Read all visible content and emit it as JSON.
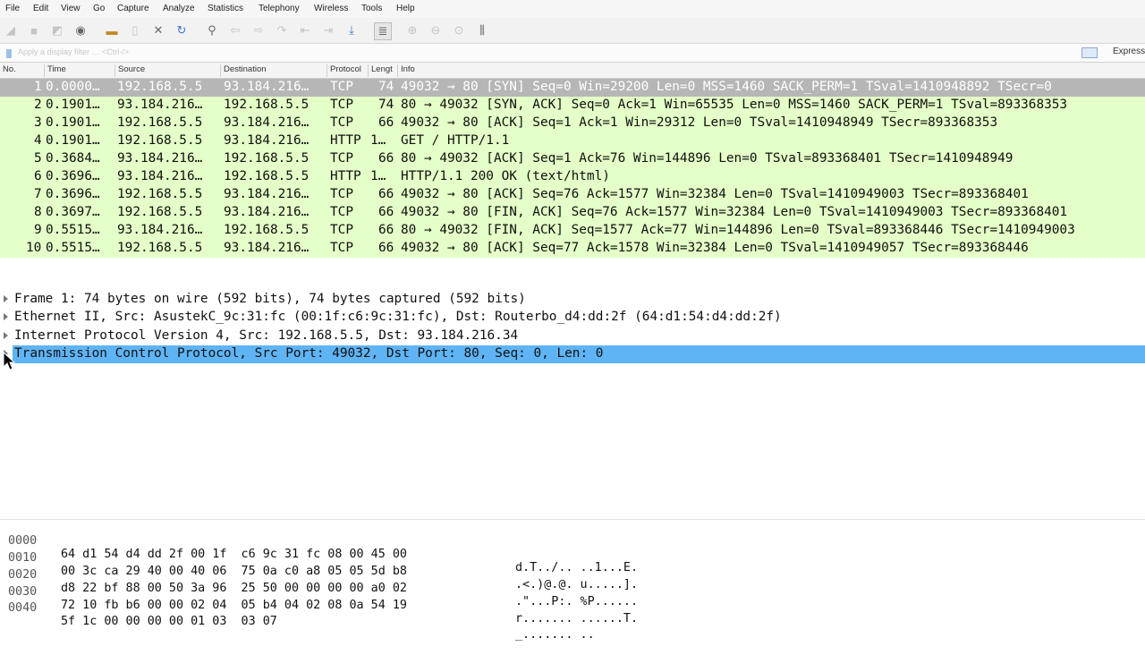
{
  "menu": [
    "File",
    "Edit",
    "View",
    "Go",
    "Capture",
    "Analyze",
    "Statistics",
    "Telephony",
    "Wireless",
    "Tools",
    "Help"
  ],
  "toolbar_icons": [
    "shark-fin-start-icon",
    "stop-square-icon",
    "restart-fin-icon",
    "capture-options-icon",
    "open-folder-icon",
    "save-file-icon",
    "close-file-icon",
    "reload-icon",
    "find-magnifier-icon",
    "back-arrow-icon",
    "forward-arrow-icon",
    "go-to-packet-icon",
    "first-packet-icon",
    "last-packet-icon",
    "autoscroll-icon",
    "colorize-icon",
    "zoom-in-icon",
    "zoom-out-icon",
    "normal-size-icon",
    "resize-columns-icon"
  ],
  "filter": {
    "placeholder": "Apply a display filter … <Ctrl-/>",
    "expression_label": "Express"
  },
  "columns": [
    "No.",
    "Time",
    "Source",
    "Destination",
    "Protocol",
    "Lengt",
    "Info"
  ],
  "packets": [
    {
      "no": "1",
      "time": "0.0000…",
      "src": "192.168.5.5",
      "dst": "93.184.216…",
      "proto": "TCP",
      "len": "74",
      "info": "49032 → 80 [SYN] Seq=0 Win=29200 Len=0 MSS=1460 SACK_PERM=1 TSval=1410948892 TSecr=0"
    },
    {
      "no": "2",
      "time": "0.1901…",
      "src": "93.184.216…",
      "dst": "192.168.5.5",
      "proto": "TCP",
      "len": "74",
      "info": "80 → 49032 [SYN, ACK] Seq=0 Ack=1 Win=65535 Len=0 MSS=1460 SACK_PERM=1 TSval=893368353"
    },
    {
      "no": "3",
      "time": "0.1901…",
      "src": "192.168.5.5",
      "dst": "93.184.216…",
      "proto": "TCP",
      "len": "66",
      "info": "49032 → 80 [ACK] Seq=1 Ack=1 Win=29312 Len=0 TSval=1410948949 TSecr=893368353"
    },
    {
      "no": "4",
      "time": "0.1901…",
      "src": "192.168.5.5",
      "dst": "93.184.216…",
      "proto": "HTTP",
      "len": "1…",
      "info": "GET / HTTP/1.1"
    },
    {
      "no": "5",
      "time": "0.3684…",
      "src": "93.184.216…",
      "dst": "192.168.5.5",
      "proto": "TCP",
      "len": "66",
      "info": "80 → 49032 [ACK] Seq=1 Ack=76 Win=144896 Len=0 TSval=893368401 TSecr=1410948949"
    },
    {
      "no": "6",
      "time": "0.3696…",
      "src": "93.184.216…",
      "dst": "192.168.5.5",
      "proto": "HTTP",
      "len": "1…",
      "info": "HTTP/1.1 200 OK  (text/html)"
    },
    {
      "no": "7",
      "time": "0.3696…",
      "src": "192.168.5.5",
      "dst": "93.184.216…",
      "proto": "TCP",
      "len": "66",
      "info": "49032 → 80 [ACK] Seq=76 Ack=1577 Win=32384 Len=0 TSval=1410949003 TSecr=893368401"
    },
    {
      "no": "8",
      "time": "0.3697…",
      "src": "192.168.5.5",
      "dst": "93.184.216…",
      "proto": "TCP",
      "len": "66",
      "info": "49032 → 80 [FIN, ACK] Seq=76 Ack=1577 Win=32384 Len=0 TSval=1410949003 TSecr=893368401"
    },
    {
      "no": "9",
      "time": "0.5515…",
      "src": "93.184.216…",
      "dst": "192.168.5.5",
      "proto": "TCP",
      "len": "66",
      "info": "80 → 49032 [FIN, ACK] Seq=1577 Ack=77 Win=144896 Len=0 TSval=893368446 TSecr=1410949003"
    },
    {
      "no": "10",
      "time": "0.5515…",
      "src": "192.168.5.5",
      "dst": "93.184.216…",
      "proto": "TCP",
      "len": "66",
      "info": "49032 → 80 [ACK] Seq=77 Ack=1578 Win=32384 Len=0 TSval=1410949057 TSecr=893368446"
    }
  ],
  "details": [
    {
      "text": "Frame 1: 74 bytes on wire (592 bits), 74 bytes captured (592 bits)"
    },
    {
      "text": "Ethernet II, Src: AsustekC_9c:31:fc (00:1f:c6:9c:31:fc), Dst: Routerbo_d4:dd:2f (64:d1:54:d4:dd:2f)"
    },
    {
      "text": "Internet Protocol Version 4, Src: 192.168.5.5, Dst: 93.184.216.34"
    },
    {
      "text": "Transmission Control Protocol, Src Port: 49032, Dst Port: 80, Seq: 0, Len: 0"
    }
  ],
  "hex": [
    {
      "off": "0000",
      "bytes": "64 d1 54 d4 dd 2f 00 1f  c6 9c 31 fc 08 00 45 00",
      "ascii": "d.T../.. ..1...E."
    },
    {
      "off": "0010",
      "bytes": "00 3c ca 29 40 00 40 06  75 0a c0 a8 05 05 5d b8",
      "ascii": ".<.)@.@. u.....]."
    },
    {
      "off": "0020",
      "bytes": "d8 22 bf 88 00 50 3a 96  25 50 00 00 00 00 a0 02",
      "ascii": ".\"...P:. %P......"
    },
    {
      "off": "0030",
      "bytes": "72 10 fb b6 00 00 02 04  05 b4 04 02 08 0a 54 19",
      "ascii": "r....... ......T."
    },
    {
      "off": "0040",
      "bytes": "5f 1c 00 00 00 00 01 03  03 07",
      "ascii": "_....... .."
    }
  ],
  "colors": {
    "tcp_row": "#e4ffc7",
    "selected_row": "#b6b6b6",
    "selected_detail": "#5fb4f5"
  }
}
